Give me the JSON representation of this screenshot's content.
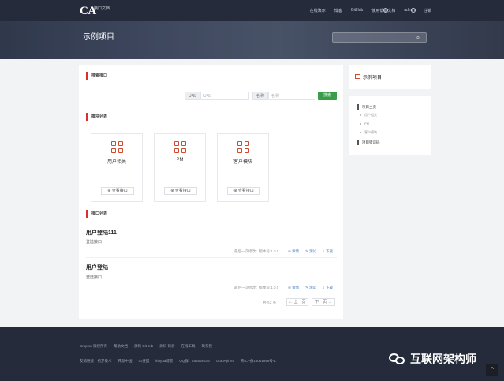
{
  "header": {
    "logo_text": "CA",
    "logo_sub": "接口文档",
    "nav": [
      "在线演示",
      "博客",
      "GitHub",
      "使用帮助文档",
      "admin",
      "注销"
    ],
    "page_title": "示例项目"
  },
  "search": {
    "section_title": "搜索接口",
    "url_label": "URL",
    "url_placeholder": "URL",
    "name_label": "名称",
    "name_placeholder": "名称",
    "button_label": "搜索"
  },
  "modules": {
    "section_title": "模块列表",
    "items": [
      {
        "name": "用户相关",
        "button": "查看接口"
      },
      {
        "name": "PM",
        "button": "查看接口"
      },
      {
        "name": "客户模块",
        "button": "查看接口"
      }
    ]
  },
  "apis": {
    "section_title": "接口列表",
    "items": [
      {
        "title": "用户登陆111",
        "desc": "登陆接口",
        "meta": "最后一次修改：版本号:1.0.0",
        "actions": [
          "详情",
          "测试",
          "下载"
        ]
      },
      {
        "title": "用户登陆",
        "desc": "登陆接口",
        "meta": "最后一次修改：版本号:1.0.0",
        "actions": [
          "详情",
          "测试",
          "下载"
        ]
      }
    ],
    "pager_info": "共有2 条",
    "prev": "← 上一页",
    "next": "下一页 →"
  },
  "sidebar": {
    "project_title": "示例项目",
    "groups": [
      {
        "label": "项目主页",
        "items": [
          "用户相关",
          "PM",
          "客户模块"
        ]
      },
      {
        "label": "项目错误码",
        "items": []
      }
    ]
  },
  "footer": {
    "row1": [
      "Crap.cn 版权所有",
      "帮助文档",
      "源码 GitHub",
      "源码 码云",
      "在线工具",
      "联系我"
    ],
    "row2": [
      "友情链接：初梦技术",
      "开源中国",
      "IG搜狐",
      "kittyua博客",
      "QQ群：254059436",
      "CrapApi V8",
      "粤ICP备15061956号-1"
    ]
  },
  "watermark": {
    "text": "互联网架构师"
  },
  "colors": {
    "accent": "#d9302c",
    "search_button": "#3a9d4a",
    "header_bg": "#252b3a"
  }
}
